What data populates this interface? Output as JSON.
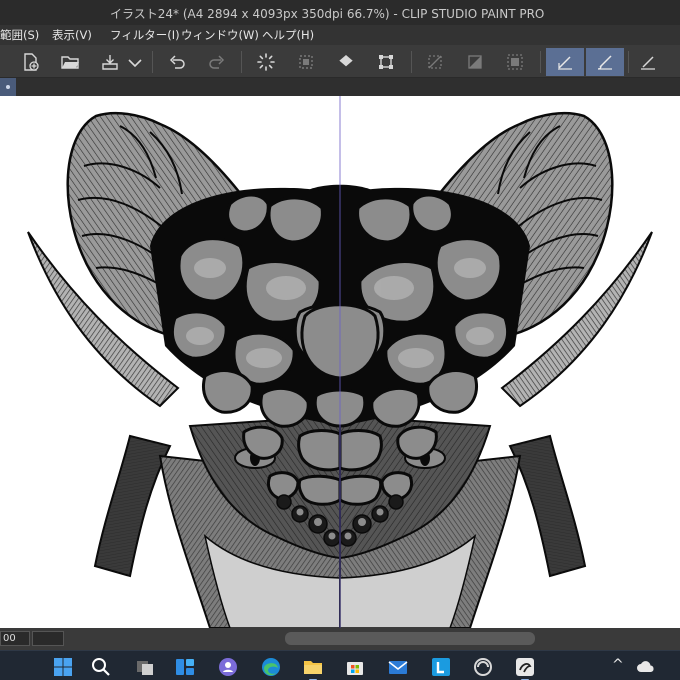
{
  "window": {
    "title": "イラスト24* (A4 2894 x 4093px 350dpi 66.7%)  - CLIP STUDIO PAINT PRO"
  },
  "menu": [
    {
      "label": "範囲(S)"
    },
    {
      "label": "表示(V)"
    },
    {
      "label": "フィルター(I)"
    },
    {
      "label": "ウィンドウ(W)"
    },
    {
      "label": "ヘルプ(H)"
    }
  ],
  "toolbar": {
    "icons": [
      "new-canvas-icon",
      "open-folder-icon",
      "save-icon",
      "dropdown-chevron-icon",
      "undo-icon",
      "redo-icon",
      "loading-spinner-icon",
      "transform-selection-icon",
      "fill-bucket-icon",
      "transform-icon",
      "clear-selection-icon",
      "invert-selection-icon",
      "selection-border-icon",
      "pen-stabilizer-icon",
      "brush-tool-icon",
      "ruler-pen-icon"
    ],
    "active": [
      "pen-stabilizer-icon",
      "brush-tool-icon"
    ]
  },
  "status": {
    "zoom_value": "00"
  },
  "taskbar": {
    "apps": [
      "windows-start-icon",
      "search-icon",
      "task-view-icon",
      "widgets-icon",
      "teams-chat-icon",
      "edge-browser-icon",
      "file-explorer-icon",
      "microsoft-store-icon",
      "mail-icon",
      "lightroom-icon",
      "clip-studio-launcher-icon",
      "clip-studio-paint-icon"
    ],
    "tray": [
      "tray-overflow-icon",
      "weather-cloud-icon"
    ]
  },
  "colors": {
    "titlebar": "#2b2b2b",
    "menubar": "#333333",
    "toolbar": "#3b3b3b",
    "active_tool": "#5b6f94",
    "canvas": "#ffffff",
    "taskbar": "#202833",
    "ink": "#0a0a0a",
    "tone_gray": "#8c8c8c",
    "horn_gray": "#b3b3b3",
    "symmetry_guide": "#6b5fc7"
  }
}
